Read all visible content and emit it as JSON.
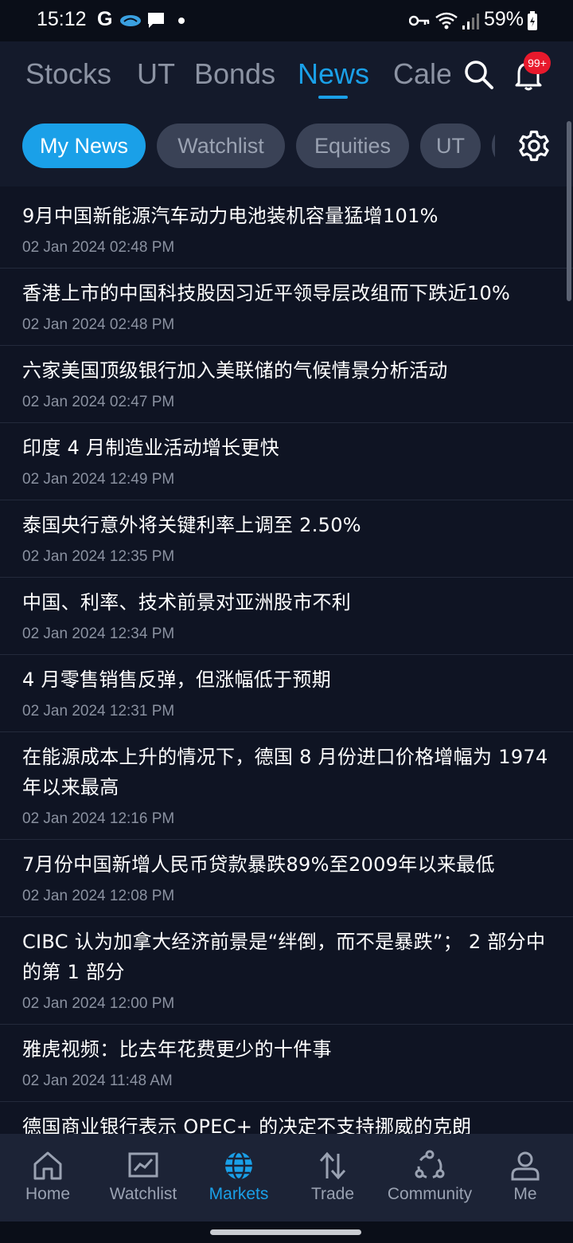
{
  "status_bar": {
    "time": "15:12",
    "g_label": "G",
    "battery": "59%"
  },
  "top_tabs": [
    {
      "label": "Stocks"
    },
    {
      "label": "UT"
    },
    {
      "label": "Bonds"
    },
    {
      "label": "News",
      "active": true
    },
    {
      "label": "Cale"
    }
  ],
  "notifications": {
    "badge": "99+"
  },
  "chips": [
    {
      "label": "My News",
      "active": true
    },
    {
      "label": "Watchlist"
    },
    {
      "label": "Equities"
    },
    {
      "label": "UT"
    }
  ],
  "news": [
    {
      "title": "9月中国新能源汽车动力电池装机容量猛增101%",
      "date": "02 Jan 2024 02:48 PM"
    },
    {
      "title": "香港上市的中国科技股因习近平领导层改组而下跌近10%",
      "date": "02 Jan 2024 02:48 PM"
    },
    {
      "title": "六家美国顶级银行加入美联储的气候情景分析活动",
      "date": "02 Jan 2024 02:47 PM"
    },
    {
      "title": "印度 4 月制造业活动增长更快",
      "date": "02 Jan 2024 12:49 PM"
    },
    {
      "title": "泰国央行意外将关键利率上调至 2.50%",
      "date": "02 Jan 2024 12:35 PM"
    },
    {
      "title": "中国、利率、技术前景对亚洲股市不利",
      "date": "02 Jan 2024 12:34 PM"
    },
    {
      "title": "4 月零售销售反弹，但涨幅低于预期",
      "date": "02 Jan 2024 12:31 PM"
    },
    {
      "title": "在能源成本上升的情况下，德国 8 月份进口价格增幅为 1974 年以来最高",
      "date": "02 Jan 2024 12:16 PM"
    },
    {
      "title": "7月份中国新增人民币贷款暴跌89%至2009年以来最低",
      "date": "02 Jan 2024 12:08 PM"
    },
    {
      "title": "CIBC 认为加拿大经济前景是“绊倒，而不是暴跌”； 2 部分中的第 1 部分",
      "date": "02 Jan 2024 12:00 PM"
    },
    {
      "title": "雅虎视频：比去年花费更少的十件事",
      "date": "02 Jan 2024 11:48 AM"
    },
    {
      "title": "德国商业银行表示 OPEC+ 的决定不支持挪威的克朗",
      "date": ""
    }
  ],
  "bottom_nav": [
    {
      "label": "Home",
      "icon": "home-icon"
    },
    {
      "label": "Watchlist",
      "icon": "chart-icon"
    },
    {
      "label": "Markets",
      "icon": "globe-icon",
      "active": true
    },
    {
      "label": "Trade",
      "icon": "transfer-icon"
    },
    {
      "label": "Community",
      "icon": "community-icon"
    },
    {
      "label": "Me",
      "icon": "person-icon"
    }
  ],
  "colors": {
    "accent": "#1aa0e8",
    "background": "#0f1423",
    "header": "#141a2b",
    "badge": "#e8192c"
  }
}
